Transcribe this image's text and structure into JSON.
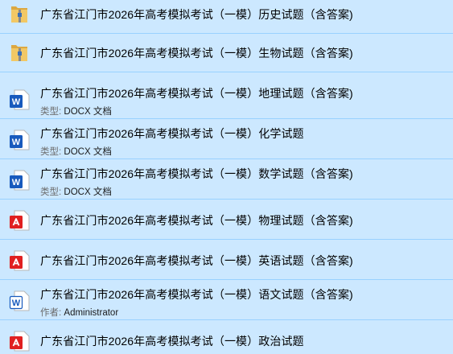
{
  "files": [
    {
      "name": "广东省江门市2026年高考模拟考试（一模）历史试题（含答案)",
      "icon": "zip-folder-icon",
      "meta_label": "",
      "meta_value": ""
    },
    {
      "name": "广东省江门市2026年高考模拟考试（一模）生物试题（含答案)",
      "icon": "zip-folder-icon",
      "meta_label": "",
      "meta_value": ""
    },
    {
      "name": "广东省江门市2026年高考模拟考试（一模）地理试题（含答案)",
      "icon": "word-doc-icon",
      "meta_label": "类型:",
      "meta_value": "DOCX 文档"
    },
    {
      "name": "广东省江门市2026年高考模拟考试（一模）化学试题",
      "icon": "word-doc-icon",
      "meta_label": "类型:",
      "meta_value": "DOCX 文档"
    },
    {
      "name": "广东省江门市2026年高考模拟考试（一模）数学试题（含答案)",
      "icon": "word-doc-icon",
      "meta_label": "类型:",
      "meta_value": "DOCX 文档"
    },
    {
      "name": "广东省江门市2026年高考模拟考试（一模）物理试题（含答案)",
      "icon": "pdf-icon",
      "meta_label": "",
      "meta_value": ""
    },
    {
      "name": "广东省江门市2026年高考模拟考试（一模）英语试题（含答案)",
      "icon": "pdf-icon",
      "meta_label": "",
      "meta_value": ""
    },
    {
      "name": "广东省江门市2026年高考模拟考试（一模）语文试题（含答案)",
      "icon": "word-doc-outline-icon",
      "meta_label": "作者:",
      "meta_value": "Administrator"
    },
    {
      "name": "广东省江门市2026年高考模拟考试（一模）政治试题",
      "icon": "pdf-icon",
      "meta_label": "",
      "meta_value": ""
    }
  ],
  "colors": {
    "selection_bg": "#cce8ff",
    "selection_border": "#99d1ff",
    "word_blue": "#185abd",
    "pdf_red": "#e02020",
    "zip_yellow": "#e9b84a"
  }
}
